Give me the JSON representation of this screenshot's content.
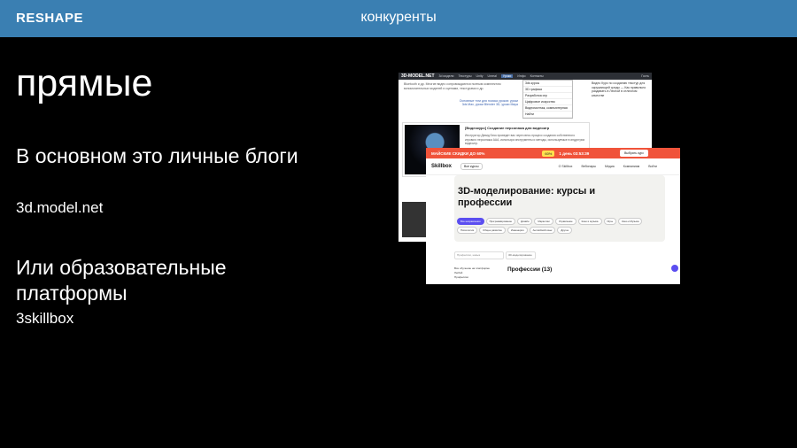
{
  "header": {
    "logo": "RESHAPE",
    "title": "конкуренты"
  },
  "heading": "прямые",
  "blocks": [
    {
      "title": "В основном это личные блоги",
      "subtitle": "3d.model.net"
    },
    {
      "title": "Или образовательные платформы",
      "subtitle": "3skillbox"
    }
  ],
  "screenshot1": {
    "brand": "3D-MODEL.NET",
    "nav": [
      "3d модели",
      "Текстуры",
      "Unity",
      "Unreal",
      "Уроки",
      "Инфо",
      "Контакты",
      "Гость"
    ],
    "menu": [
      "3ds курсы",
      "3D графика",
      "Разработка игр",
      "Цифровое искусство",
      "Видеомонтаж, компьютерная",
      "Найти"
    ],
    "text": "Bluetooth и др. Многие видео сопровождаются полным комплектом вспомогательных моделей и сценами, текстурами и др.",
    "link": "Основные тэги для поиска уроков: уроки 3ds Max, уроки Blender 3D, уроки Maya",
    "sidebar": "Видео Курс по созданию текстур для окружающей среды — Как правильно раздавать в Лесной в отличном качестве",
    "card_title": "[Видеокурс] Создание персонажа для видеоигр",
    "card_text": "Инструктор Дэвид Беск проведет вас через весь процесс создания собственного игрового персонажа AAA, используя инструменты и методы, используемые в индустрии видеоигр."
  },
  "screenshot2": {
    "promo": "МАЙСКИЕ СКИДКИ ДО 60%",
    "badge": "60%",
    "timer": "1 день 03:53:39",
    "promo_button": "Выбрать курс",
    "logo": "Skillbox",
    "courses_button": "Все курсы",
    "nav": [
      "О Skillbox",
      "Вебинары",
      "Медиа",
      "Компаниям",
      "Войти"
    ],
    "title": "3D-моделирование: курсы и профессии",
    "chips": [
      "Все направления",
      "Программирование",
      "Дизайн",
      "Маркетинг",
      "Управление",
      "Кино и музыка",
      "Игры",
      "Кино и Музыка",
      "Психология",
      "Общее развитие",
      "Инженерия",
      "Английский язык",
      "Другое"
    ],
    "search_placeholder": "Профессии, навык",
    "filter": "3D-моделирование",
    "sidebar": [
      "Все обучение на платформе",
      "Любой",
      "Профессии"
    ],
    "section": "Профессии (13)"
  }
}
